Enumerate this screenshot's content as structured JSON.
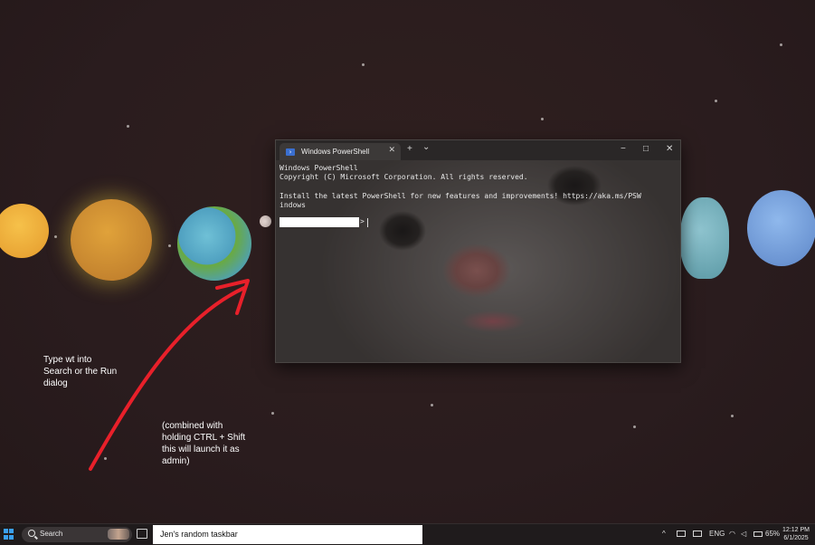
{
  "desktop": {
    "annotations": [
      "Type wt into\nSearch or the Run\ndialog",
      "(combined with\nholding CTRL + Shift\nthis will launch it as\nadmin)"
    ]
  },
  "terminal": {
    "tab_title": "Windows PowerShell",
    "tab_close": "✕",
    "new_tab": "+",
    "dropdown": "⌄",
    "minimize": "−",
    "maximize": "□",
    "close": "✕",
    "output": "Windows PowerShell\nCopyright (C) Microsoft Corporation. All rights reserved.\n\nInstall the latest PowerShell for new features and improvements! https://aka.ms/PSW\nindows",
    "prompt_suffix": ">"
  },
  "taskbar": {
    "search_label": "Search",
    "custom_text": "Jen's random taskbar",
    "tray": {
      "chevron": "^",
      "language": "ENG",
      "battery": "65%"
    },
    "clock_time": "12:12 PM",
    "clock_date": "6/1/2025"
  },
  "colors": {
    "accent": "#3aa0f0",
    "arrow": "#e8202a",
    "desktop_bg": "#2b1d1f"
  }
}
